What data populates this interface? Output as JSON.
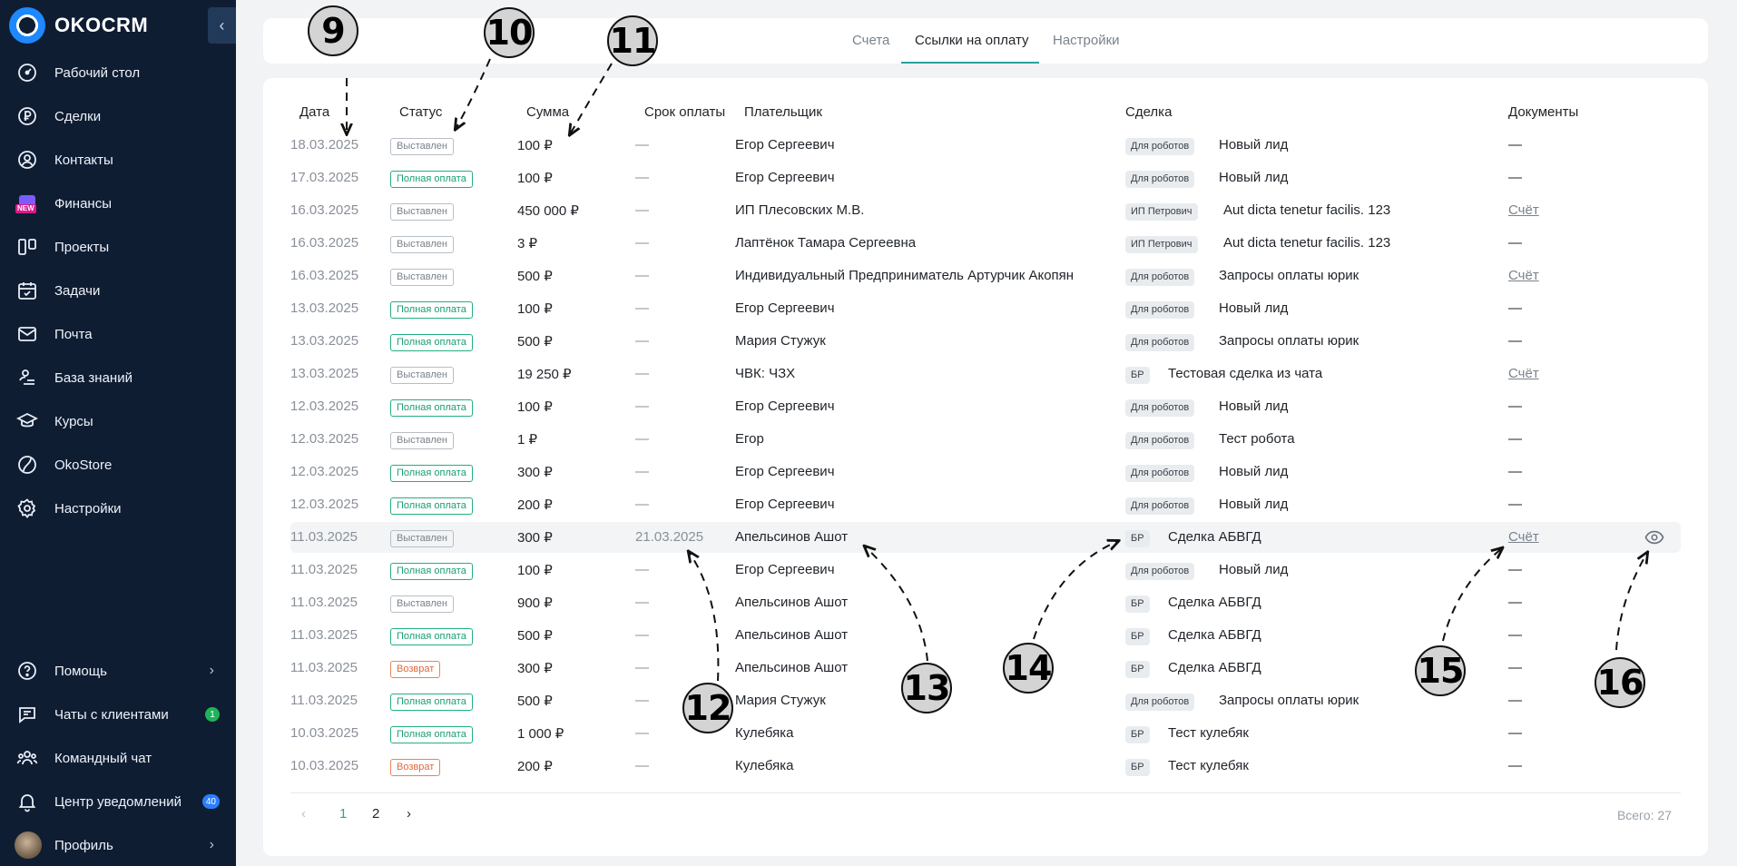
{
  "sidebar": {
    "brand": "OKOCRM",
    "collapse_icon": "‹",
    "items": [
      {
        "label": "Рабочий стол",
        "icon": "dashboard-icon"
      },
      {
        "label": "Сделки",
        "icon": "ruble-icon"
      },
      {
        "label": "Контакты",
        "icon": "contacts-icon"
      },
      {
        "label": "Финансы",
        "icon": "finance-icon",
        "badge": "NEW"
      },
      {
        "label": "Проекты",
        "icon": "projects-icon"
      },
      {
        "label": "Задачи",
        "icon": "calendar-icon"
      },
      {
        "label": "Почта",
        "icon": "mail-icon"
      },
      {
        "label": "База знаний",
        "icon": "knowledge-icon"
      },
      {
        "label": "Курсы",
        "icon": "courses-icon"
      },
      {
        "label": "OkoStore",
        "icon": "store-icon"
      },
      {
        "label": "Настройки",
        "icon": "gear-icon"
      }
    ],
    "bottom": [
      {
        "label": "Помощь",
        "icon": "help-icon",
        "chevron": "›"
      },
      {
        "label": "Чаты с клиентами",
        "icon": "chat-icon",
        "count": "1"
      },
      {
        "label": "Командный чат",
        "icon": "team-icon"
      },
      {
        "label": "Центр уведомлений",
        "icon": "bell-icon",
        "count": "40"
      },
      {
        "label": "Профиль",
        "icon": "avatar",
        "chevron": "›"
      }
    ]
  },
  "tabs": [
    {
      "label": "Счета"
    },
    {
      "label": "Ссылки на оплату",
      "active": true
    },
    {
      "label": "Настройки"
    }
  ],
  "table": {
    "headers": {
      "date": "Дата",
      "status": "Статус",
      "sum": "Сумма",
      "due": "Срок оплаты",
      "payer": "Плательщик",
      "deal": "Сделка",
      "docs": "Документы"
    },
    "rows": [
      {
        "date": "18.03.2025",
        "status": "Выставлен",
        "kind": "issued",
        "sum": "100 ₽",
        "due": "—",
        "payer": "Егор Сергеевич",
        "deal_tag": "Для роботов",
        "deal": "Новый лид",
        "docs": "—"
      },
      {
        "date": "17.03.2025",
        "status": "Полная оплата",
        "kind": "paid",
        "sum": "100 ₽",
        "due": "—",
        "payer": "Егор Сергеевич",
        "deal_tag": "Для роботов",
        "deal": "Новый лид",
        "docs": "—"
      },
      {
        "date": "16.03.2025",
        "status": "Выставлен",
        "kind": "issued",
        "sum": "450 000 ₽",
        "due": "—",
        "payer": "ИП Плесовских М.В.",
        "deal_tag": "ИП Петрович",
        "deal": "Aut dicta tenetur facilis. 123",
        "docs": "Счёт"
      },
      {
        "date": "16.03.2025",
        "status": "Выставлен",
        "kind": "issued",
        "sum": "3 ₽",
        "due": "—",
        "payer": "Лаптёнок Тамара Сергеевна",
        "deal_tag": "ИП Петрович",
        "deal": "Aut dicta tenetur facilis. 123",
        "docs": "—"
      },
      {
        "date": "16.03.2025",
        "status": "Выставлен",
        "kind": "issued",
        "sum": "500 ₽",
        "due": "—",
        "payer": "Индивидуальный Предприниматель Артурчик Акопян",
        "deal_tag": "Для роботов",
        "deal": "Запросы оплаты юрик",
        "docs": "Счёт"
      },
      {
        "date": "13.03.2025",
        "status": "Полная оплата",
        "kind": "paid",
        "sum": "100 ₽",
        "due": "—",
        "payer": "Егор Сергеевич",
        "deal_tag": "Для роботов",
        "deal": "Новый лид",
        "docs": "—"
      },
      {
        "date": "13.03.2025",
        "status": "Полная оплата",
        "kind": "paid",
        "sum": "500 ₽",
        "due": "—",
        "payer": "Мария Стужук",
        "deal_tag": "Для роботов",
        "deal": "Запросы оплаты юрик",
        "docs": "—"
      },
      {
        "date": "13.03.2025",
        "status": "Выставлен",
        "kind": "issued",
        "sum": "19 250 ₽",
        "due": "—",
        "payer": "ЧВК: ЧЗХ",
        "deal_tag": "БР",
        "deal": "Тестовая сделка из чата",
        "docs": "Счёт"
      },
      {
        "date": "12.03.2025",
        "status": "Полная оплата",
        "kind": "paid",
        "sum": "100 ₽",
        "due": "—",
        "payer": "Егор Сергеевич",
        "deal_tag": "Для роботов",
        "deal": "Новый лид",
        "docs": "—"
      },
      {
        "date": "12.03.2025",
        "status": "Выставлен",
        "kind": "issued",
        "sum": "1 ₽",
        "due": "—",
        "payer": "Егор",
        "deal_tag": "Для роботов",
        "deal": "Тест робота",
        "docs": "—"
      },
      {
        "date": "12.03.2025",
        "status": "Полная оплата",
        "kind": "paid",
        "sum": "300 ₽",
        "due": "—",
        "payer": "Егор Сергеевич",
        "deal_tag": "Для роботов",
        "deal": "Новый лид",
        "docs": "—"
      },
      {
        "date": "12.03.2025",
        "status": "Полная оплата",
        "kind": "paid",
        "sum": "200 ₽",
        "due": "—",
        "payer": "Егор Сергеевич",
        "deal_tag": "Для роботов",
        "deal": "Новый лид",
        "docs": "—"
      },
      {
        "date": "11.03.2025",
        "status": "Выставлен",
        "kind": "issued",
        "sum": "300 ₽",
        "due": "21.03.2025",
        "payer": "Апельсинов Ашот",
        "deal_tag": "БР",
        "deal": "Сделка АБВГД",
        "docs": "Счёт",
        "highlight": true
      },
      {
        "date": "11.03.2025",
        "status": "Полная оплата",
        "kind": "paid",
        "sum": "100 ₽",
        "due": "—",
        "payer": "Егор Сергеевич",
        "deal_tag": "Для роботов",
        "deal": "Новый лид",
        "docs": "—"
      },
      {
        "date": "11.03.2025",
        "status": "Выставлен",
        "kind": "issued",
        "sum": "900 ₽",
        "due": "—",
        "payer": "Апельсинов Ашот",
        "deal_tag": "БР",
        "deal": "Сделка АБВГД",
        "docs": "—"
      },
      {
        "date": "11.03.2025",
        "status": "Полная оплата",
        "kind": "paid",
        "sum": "500 ₽",
        "due": "—",
        "payer": "Апельсинов Ашот",
        "deal_tag": "БР",
        "deal": "Сделка АБВГД",
        "docs": "—"
      },
      {
        "date": "11.03.2025",
        "status": "Возврат",
        "kind": "refund",
        "sum": "300 ₽",
        "due": "—",
        "payer": "Апельсинов Ашот",
        "deal_tag": "БР",
        "deal": "Сделка АБВГД",
        "docs": "—"
      },
      {
        "date": "11.03.2025",
        "status": "Полная оплата",
        "kind": "paid",
        "sum": "500 ₽",
        "due": "—",
        "payer": "Мария Стужук",
        "deal_tag": "Для роботов",
        "deal": "Запросы оплаты юрик",
        "docs": "—"
      },
      {
        "date": "10.03.2025",
        "status": "Полная оплата",
        "kind": "paid",
        "sum": "1 000 ₽",
        "due": "—",
        "payer": "Кулебяка",
        "deal_tag": "БР",
        "deal": "Тест кулебяк",
        "docs": "—"
      },
      {
        "date": "10.03.2025",
        "status": "Возврат",
        "kind": "refund",
        "sum": "200 ₽",
        "due": "—",
        "payer": "Кулебяка",
        "deal_tag": "БР",
        "deal": "Тест кулебяк",
        "docs": "—"
      }
    ]
  },
  "pagination": {
    "prev": "‹",
    "pages": [
      "1",
      "2"
    ],
    "current": "1",
    "next": "›",
    "total": "Всего: 27"
  },
  "callouts": [
    "9",
    "10",
    "11",
    "12",
    "13",
    "14",
    "15",
    "16"
  ],
  "colors": {
    "sidebar": "#0f1d33",
    "accent": "#2aa3a0",
    "paid": "#19a06f",
    "refund": "#e0693d",
    "badge_green": "#1fb35a",
    "badge_blue": "#2a7fff"
  }
}
